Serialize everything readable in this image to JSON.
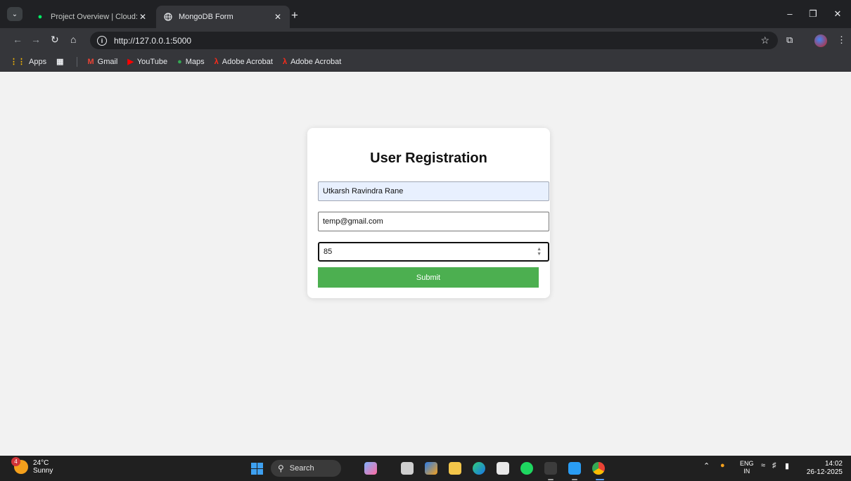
{
  "browser": {
    "tabs": [
      {
        "title": "Project Overview | Cloud: Mong",
        "active": false
      },
      {
        "title": "MongoDB Form",
        "active": true
      }
    ],
    "url": "http://127.0.0.1:5000",
    "bookmarks": [
      {
        "label": "Apps"
      },
      {
        "label": "Gmail"
      },
      {
        "label": "YouTube"
      },
      {
        "label": "Maps"
      },
      {
        "label": "Adobe Acrobat"
      },
      {
        "label": "Adobe Acrobat"
      }
    ]
  },
  "form": {
    "title": "User Registration",
    "name_value": "Utkarsh Ravindra Rane",
    "email_value": "temp@gmail.com",
    "age_value": "85",
    "submit_label": "Submit",
    "submit_color": "#4caf50"
  },
  "taskbar": {
    "weather_temp": "24°C",
    "weather_desc": "Sunny",
    "weather_badge": "4",
    "search_label": "Search",
    "lang_top": "ENG",
    "lang_bottom": "IN",
    "time": "14:02",
    "date": "26-12-2025"
  }
}
